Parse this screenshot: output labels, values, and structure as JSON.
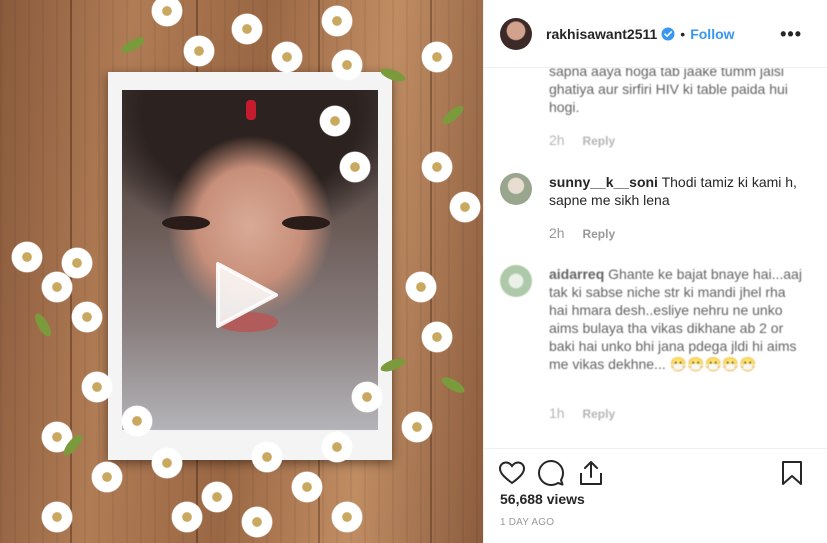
{
  "header": {
    "username": "rakhisawant2511",
    "separator": "•",
    "follow_label": "Follow",
    "more_label": "•••"
  },
  "comments": [
    {
      "username": "",
      "text": "sapna aaya hoga tab jaake tumm jaisi ghatiya aur sirfiri HIV ki table paida hui hogi.",
      "time": "2h",
      "reply_label": "Reply"
    },
    {
      "username": "sunny__k__soni",
      "text": "Thodi tamiz ki kami h, sapne me sikh lena",
      "time": "2h",
      "reply_label": "Reply"
    },
    {
      "username": "aidarreq",
      "text": "Ghante ke bajat bnaye hai...aaj tak ki sabse niche str ki mandi jhel rha hai hmara desh..esliye nehru ne unko aims bulaya tha vikas dikhane ab 2 or baki hai unko bhi jana pdega jldi hi aims me vikas dekhne...",
      "emoji": "😷😷😷😷😷",
      "time": "1h",
      "reply_label": "Reply"
    }
  ],
  "footer": {
    "views": "56,688 views",
    "timestamp": "1 DAY AGO"
  },
  "colors": {
    "accent": "#3897f0",
    "text": "#262626",
    "muted": "#999999"
  },
  "icons": [
    "verified-badge-icon",
    "more-options-icon",
    "heart-icon",
    "comment-icon",
    "share-icon",
    "bookmark-icon",
    "play-icon"
  ]
}
